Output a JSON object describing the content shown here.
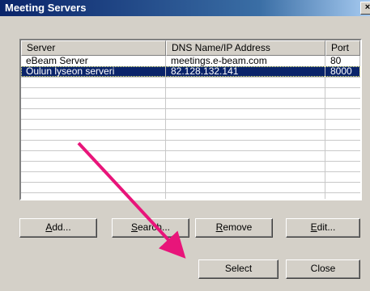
{
  "window": {
    "title": "Meeting Servers",
    "close_glyph": "×"
  },
  "list": {
    "columns": [
      "Server",
      "DNS Name/IP Address",
      "Port"
    ],
    "rows": [
      {
        "server": "eBeam Server",
        "address": "meetings.e-beam.com",
        "port": "80",
        "selected": false
      },
      {
        "server": "Oulun lyseon serveri",
        "address": "82.128.132.141",
        "port": "8000",
        "selected": true
      }
    ]
  },
  "buttons": {
    "add": {
      "mnemonic": "A",
      "rest": "dd..."
    },
    "search": {
      "mnemonic": "S",
      "rest": "earch..."
    },
    "remove": {
      "mnemonic": "R",
      "rest": "emove"
    },
    "edit": {
      "mnemonic": "E",
      "rest": "dit..."
    },
    "select": "Select",
    "close": "Close"
  },
  "annotation": {
    "arrow_color": "#e8157a",
    "points_to": "select-button"
  }
}
